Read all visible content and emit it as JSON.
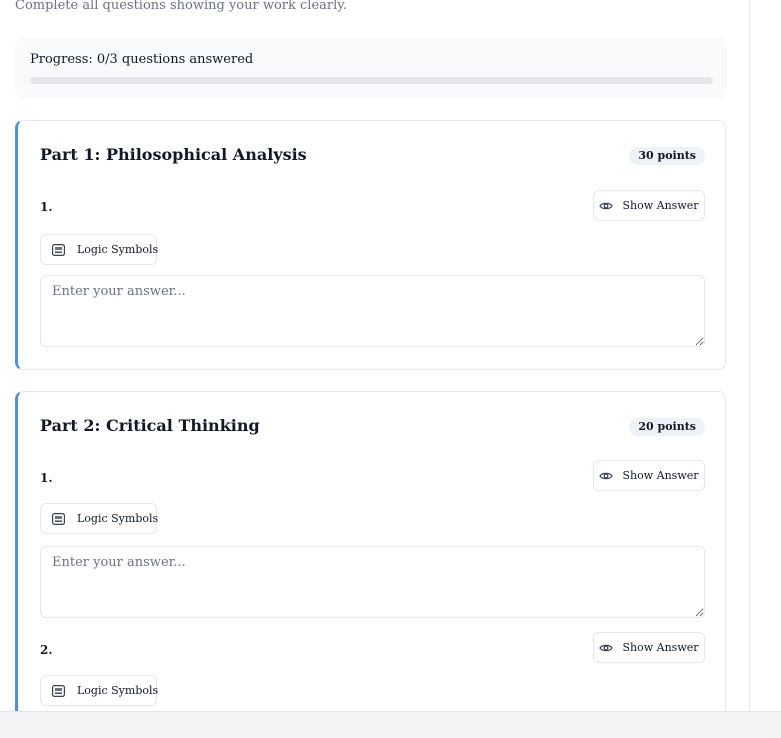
{
  "subtitle": "Complete all questions showing your work clearly.",
  "progress": {
    "label": "Progress: 0/3 questions answered",
    "answered": 0,
    "total": 3,
    "percent": 0
  },
  "colors": {
    "accent": "#4a8fe0",
    "progress_fill": "#3b82f6"
  },
  "parts": [
    {
      "title": "Part 1: Philosophical Analysis",
      "points": "30 points",
      "questions": [
        {
          "number": "1.",
          "show_answer_label": "Show Answer",
          "logic_symbols_label": "Logic Symbols",
          "answer_placeholder": "Enter your answer...",
          "answer_value": ""
        }
      ]
    },
    {
      "title": "Part 2: Critical Thinking",
      "points": "20 points",
      "questions": [
        {
          "number": "1.",
          "show_answer_label": "Show Answer",
          "logic_symbols_label": "Logic Symbols",
          "answer_placeholder": "Enter your answer...",
          "answer_value": ""
        },
        {
          "number": "2.",
          "show_answer_label": "Show Answer",
          "logic_symbols_label": "Logic Symbols"
        }
      ]
    }
  ],
  "icons": {
    "show_answer": "eye-icon",
    "logic_symbols": "keyboard-icon"
  }
}
